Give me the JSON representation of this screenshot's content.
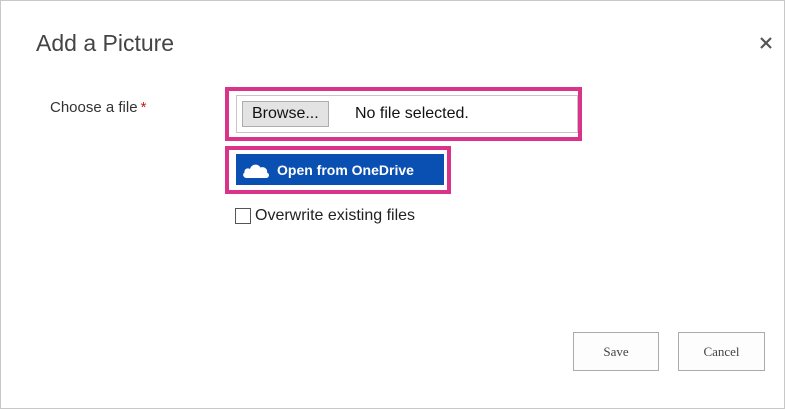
{
  "dialog": {
    "title": "Add a Picture",
    "close_icon": "close-icon"
  },
  "form": {
    "choose_file_label": "Choose a file",
    "required_marker": "*",
    "browse_label": "Browse...",
    "file_status": "No file selected.",
    "onedrive_label": "Open from OneDrive",
    "onedrive_icon": "cloud-icon",
    "overwrite_label": "Overwrite existing files",
    "overwrite_checked": false
  },
  "actions": {
    "save_label": "Save",
    "cancel_label": "Cancel"
  },
  "colors": {
    "highlight": "#d9338a",
    "onedrive_blue": "#0a4fb2",
    "required_red": "#c21a1a"
  }
}
